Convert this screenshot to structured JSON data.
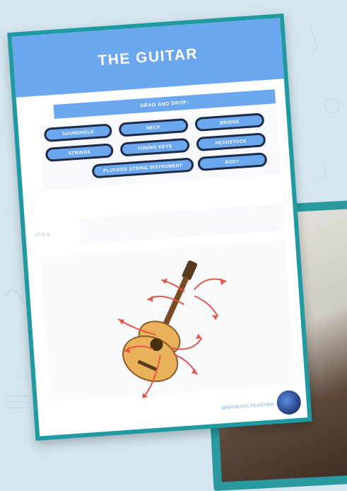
{
  "worksheet": {
    "title": "THE GUITAR",
    "instruction": "DRAG AND DROP:",
    "word_bank": [
      "SOUNDHOLE",
      "NECK",
      "BRIDGE",
      "STRINGS",
      "TUNING KEYS",
      "HEADSTOCK",
      "PLUCKED STRING INSTRUMENT",
      "BODY"
    ],
    "answer_prompt": "IT IS A",
    "footer_handle": "@MYMUSICTEACHER"
  },
  "colors": {
    "accent_blue": "#6aa7ee",
    "frame_teal": "#1f9aa3",
    "chip_border": "#1f2a44",
    "arrow_red": "#e2574c",
    "background": "#d5e6f0"
  },
  "icons": {
    "guitar": "guitar-illustration",
    "avatar": "teacher-avatar",
    "arrows": "label-arrow"
  }
}
